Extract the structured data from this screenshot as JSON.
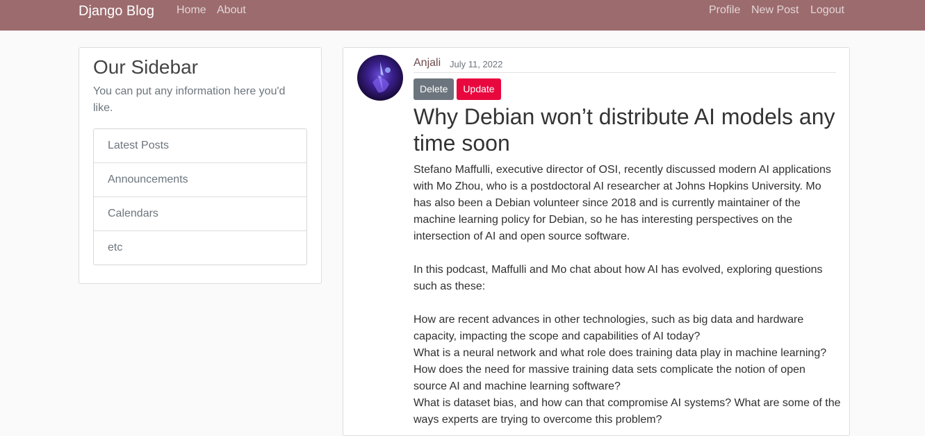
{
  "navbar": {
    "brand": "Django Blog",
    "left_links": [
      "Home",
      "About"
    ],
    "right_links": [
      "Profile",
      "New Post",
      "Logout"
    ],
    "color": "#9c6b6e"
  },
  "sidebar": {
    "title": "Our Sidebar",
    "text": "You can put any information here you'd like.",
    "items": [
      "Latest Posts",
      "Announcements",
      "Calendars",
      "etc"
    ]
  },
  "post": {
    "author": "Anjali",
    "date": "July 11, 2022",
    "delete_label": "Delete",
    "update_label": "Update",
    "title": "Why Debian won’t distribute AI models any time soon",
    "paragraphs": [
      "Stefano Maffulli, executive director of OSI, recently discussed modern AI applications with Mo Zhou, who is a postdoctoral AI researcher at Johns Hopkins University. Mo has also been a Debian volunteer since 2018 and is currently maintainer of the machine learning policy for Debian, so he has interesting perspectives on the intersection of AI and open source software.",
      "In this podcast, Maffulli and Mo chat about how AI has evolved, exploring questions such as these:"
    ],
    "questions": [
      "How are recent advances in other technologies, such as big data and hardware capacity, impacting the scope and capabilities of AI today?",
      "What is a neural network and what role does training data play in machine learning?",
      "How does the need for massive training data sets complicate the notion of open source AI and machine learning software?",
      "What is dataset bias, and how can that compromise AI systems? What are some of the ways experts are trying to overcome this problem?"
    ],
    "delete_color": "#6c757d",
    "update_color": "#e8083e",
    "avatar_icon": "user-avatar"
  }
}
